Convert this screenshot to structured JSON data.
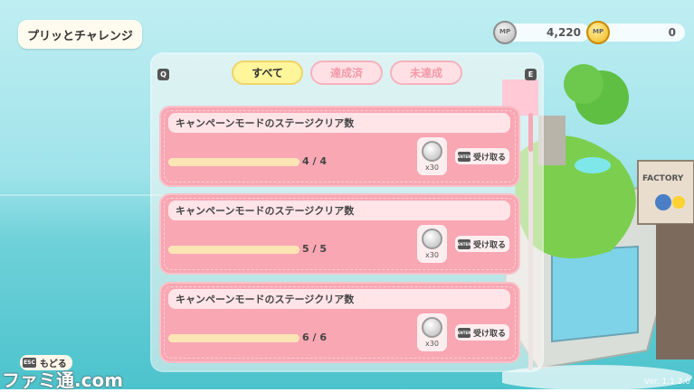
{
  "header": {
    "title": "プリッとチャレンジ"
  },
  "currency": {
    "silver": "4,220",
    "gold": "0",
    "silver_icon": "silver-coin-icon",
    "gold_icon": "gold-coin-icon"
  },
  "tab_hints": {
    "left": "Q",
    "right": "E"
  },
  "tabs": [
    {
      "label": "すべて",
      "active": true
    },
    {
      "label": "達成済",
      "active": false
    },
    {
      "label": "未達成",
      "active": false
    }
  ],
  "challenges": [
    {
      "title": "キャンペーンモードのステージクリア数",
      "progress_text": "4 / 4",
      "progress": 1.0,
      "reward_qty": "x30",
      "claim_key": "ENTER",
      "claim_label": "受け取る"
    },
    {
      "title": "キャンペーンモードのステージクリア数",
      "progress_text": "5 / 5",
      "progress": 1.0,
      "reward_qty": "x30",
      "claim_key": "ENTER",
      "claim_label": "受け取る"
    },
    {
      "title": "キャンペーンモードのステージクリア数",
      "progress_text": "6 / 6",
      "progress": 1.0,
      "reward_qty": "x30",
      "claim_key": "ENTER",
      "claim_label": "受け取る"
    }
  ],
  "scroll": {
    "position": 0.0,
    "visible_fraction": 0.15
  },
  "footer": {
    "esc_key": "ESC",
    "back_label": "もどる",
    "version": "Ver. 1.1.2.0"
  },
  "watermark": "ファミ通.com",
  "island_sign": "FACTORY",
  "colors": {
    "card": "#f9a7b3",
    "tab_active": "#fff59a",
    "tab_inactive": "#ffe1e5",
    "progress_fill": "#fce5b5"
  }
}
